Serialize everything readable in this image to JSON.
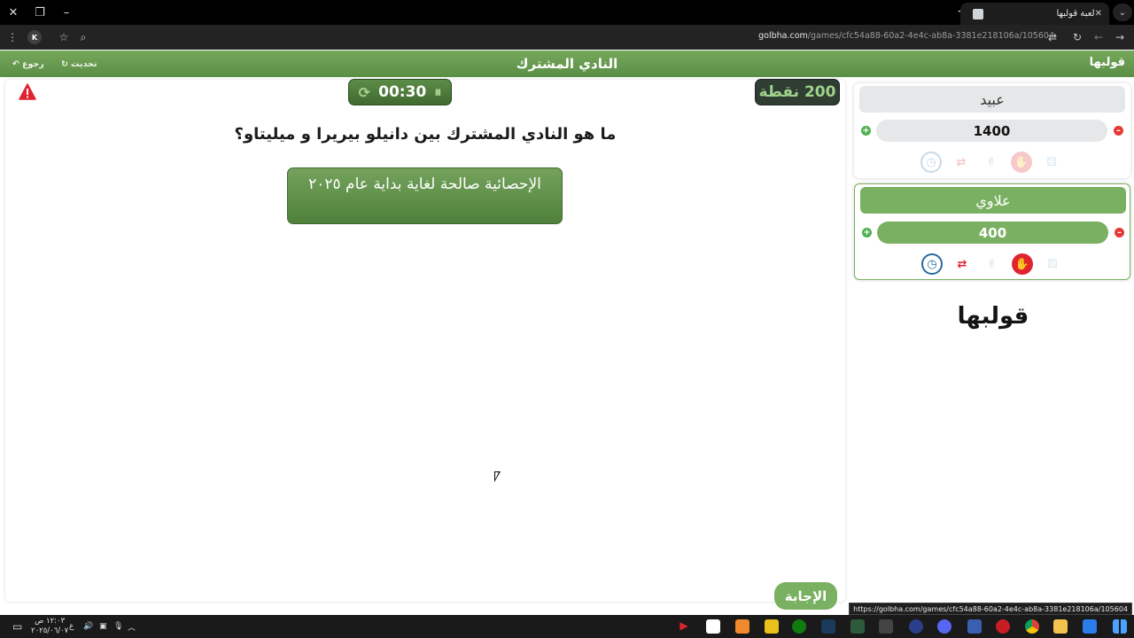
{
  "browser": {
    "tab_title": "لعبة قولبها",
    "url_host": "golbha.com",
    "url_path": "/games/cfc54a88-60a2-4e4c-ab8a-3381e218106a/105604",
    "status_url": "https://golbha.com/games/cfc54a88-60a2-4e4c-ab8a-3381e218106a/105604",
    "ext_label": "K"
  },
  "header": {
    "title": "النادي المشترك",
    "back_label": "رجوع",
    "refresh_label": "تحديث",
    "logo": "قولبها"
  },
  "game": {
    "timer": "00:30",
    "points": "200 نقطة",
    "question": "ما هو النادي المشترك بين دانيلو بيريرا و ميليتاو؟",
    "hint": "الإحصائية صالحة لغاية بداية عام ٢٠٢٥",
    "answer_label": "الإجابة"
  },
  "teams": [
    {
      "name": "عبيد",
      "score": "1400",
      "active": false
    },
    {
      "name": "علاوي",
      "score": "400",
      "active": true
    }
  ],
  "side_logo": {
    "main": "قولبها"
  },
  "taskbar": {
    "time": "١٢:٠٣ ص",
    "date": "٢٠٢٥/٠٦/٠٧",
    "lang": "ع"
  },
  "icons": {
    "warning": "warning-triangle-icon",
    "timer_refresh": "refresh-icon",
    "timer_pause": "pause-icon",
    "lifelines": [
      "stopwatch-icon",
      "swap-icon",
      "two-fingers-icon",
      "hand-stop-icon",
      "dice-icon"
    ]
  },
  "colors": {
    "brand_green": "#7ab062",
    "dark_green": "#3f6b30",
    "danger": "#e53935",
    "score_dark": "#2f3d33"
  }
}
